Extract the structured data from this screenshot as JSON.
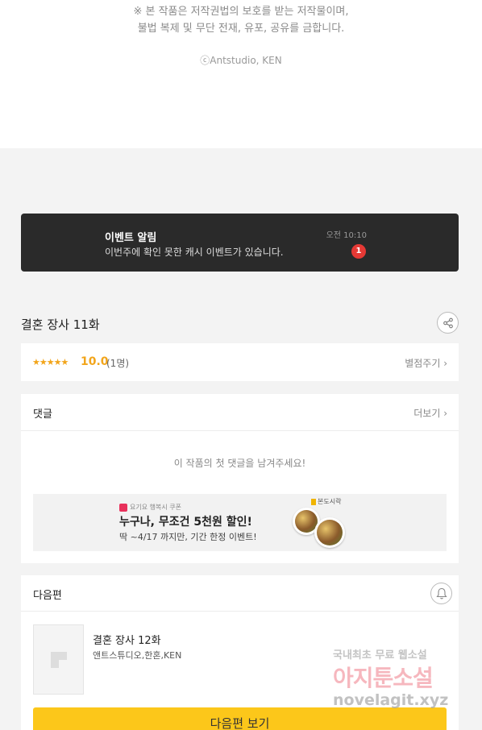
{
  "copyright": {
    "line1": "※ 본 작품은 저작권법의 보호를 받는 저작물이며,",
    "line2": "불법 복제 및 무단 전재, 유포, 공유를 금합니다.",
    "line3": "ⓒAntstudio, KEN"
  },
  "event": {
    "title": "이벤트 알림",
    "description": "이번주에 확인 못한 캐시 이벤트가 있습니다.",
    "time": "오전 10:10",
    "badge": "1"
  },
  "episode": {
    "title": "결혼 장사 11화",
    "share_icon": "share-icon"
  },
  "rating": {
    "stars": "★★★★★",
    "score": "10.0",
    "count": "(1명)",
    "rate_link": "별점주기 ›"
  },
  "comments": {
    "label": "댓글",
    "more": "더보기 ›",
    "empty_message": "이 작품의 첫 댓글을 남겨주세요!"
  },
  "ad": {
    "tag": "요기요 행복시 쿠폰",
    "headline": "누구나, 무조건 5천원 할인!",
    "subline": "딱 ~4/17 까지만, 기간 한정 이벤트!",
    "brand": "본도시락"
  },
  "next": {
    "label": "다음편",
    "bell_icon": "bell-icon",
    "episode_title": "결혼 장사 12화",
    "author": "앤트스튜디오,한혼,KEN",
    "button": "다음편 보기"
  },
  "watermark": {
    "line1": "국내최초 무료 웹소설",
    "line2": "아지툰소설",
    "line3": "novelagit.xyz"
  },
  "colors": {
    "accent": "#fcc71a",
    "star": "#f2a51b",
    "badge": "#e53935",
    "banner": "#2a2a2a"
  }
}
